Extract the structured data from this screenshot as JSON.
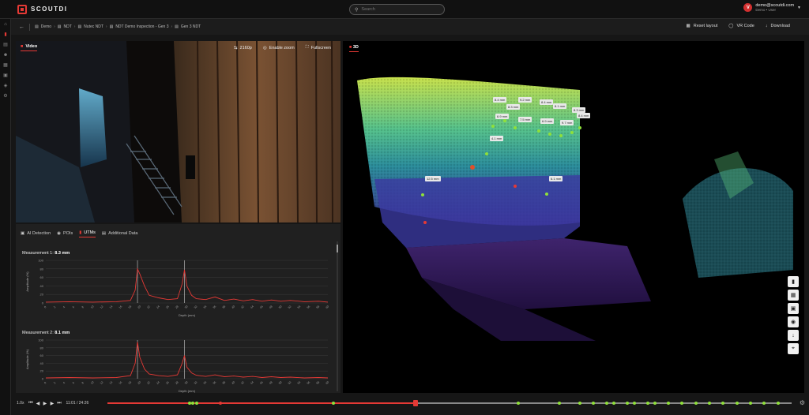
{
  "app": {
    "brand": "SCOUTDI"
  },
  "search": {
    "placeholder": "Search"
  },
  "user": {
    "initial": "V",
    "email": "demo@scoutdi.com",
    "role": "Demo • User"
  },
  "breadcrumb": [
    "Demo",
    "NDT",
    "Nutec NDT",
    "NDT Demo Inspection - Gen 3",
    "Gen 3 NDT"
  ],
  "toolbar": {
    "reset_layout": "Reset layout",
    "vr_code": "VR Code",
    "download": "Download"
  },
  "video": {
    "tab": "Video",
    "quality": "2160p",
    "zoom": "Enable zoom",
    "fullscreen": "Fullscreen"
  },
  "data_tabs": [
    "AI Detection",
    "POIs",
    "UTMs",
    "Additional Data"
  ],
  "data_active_tab": "UTMs",
  "measurements": [
    {
      "label": "Measurement 1:",
      "value": "8.3 mm"
    },
    {
      "label": "Measurement 2:",
      "value": "8.1 mm"
    }
  ],
  "chart_data": [
    {
      "type": "line",
      "title": "Measurement 1: 8.3 mm",
      "xlabel": "Depth (mm)",
      "ylabel": "Amplitude (%)",
      "ylim": [
        0,
        100
      ],
      "yticks": [
        0,
        20,
        40,
        60,
        80,
        100
      ],
      "xlim": [
        0,
        60
      ],
      "series": [
        {
          "x": [
            0,
            5,
            10,
            15,
            18,
            19,
            19.5,
            20,
            21,
            22,
            24,
            26,
            28,
            29,
            29.5,
            30,
            31,
            32,
            34,
            36,
            38,
            40,
            42,
            44,
            46,
            48,
            50,
            52,
            55,
            58,
            60
          ],
          "y": [
            2,
            3,
            2,
            3,
            6,
            30,
            80,
            68,
            40,
            18,
            12,
            8,
            10,
            45,
            78,
            40,
            18,
            10,
            8,
            14,
            6,
            9,
            5,
            8,
            4,
            7,
            4,
            6,
            3,
            4,
            2
          ]
        }
      ],
      "markers": [
        19.5,
        29.5
      ]
    },
    {
      "type": "line",
      "title": "Measurement 2: 8.1 mm",
      "xlabel": "Depth (mm)",
      "ylabel": "Amplitude (%)",
      "ylim": [
        0,
        100
      ],
      "yticks": [
        0,
        20,
        40,
        60,
        80,
        100
      ],
      "xlim": [
        0,
        60
      ],
      "series": [
        {
          "x": [
            0,
            5,
            10,
            15,
            18,
            19,
            19.5,
            20,
            21,
            22,
            24,
            26,
            28,
            29,
            29.5,
            30,
            31,
            32,
            34,
            36,
            38,
            40,
            42,
            44,
            46,
            48,
            50,
            52,
            55,
            58,
            60
          ],
          "y": [
            2,
            3,
            2,
            3,
            8,
            40,
            95,
            55,
            25,
            12,
            8,
            6,
            10,
            40,
            60,
            30,
            15,
            9,
            6,
            10,
            5,
            7,
            4,
            6,
            3,
            5,
            3,
            4,
            2,
            3,
            2
          ]
        }
      ],
      "markers": [
        19.5,
        29.5
      ]
    }
  ],
  "pointcloud_labels": [
    "8.4 mm",
    "9.2 mm",
    "8.3 mm",
    "8.4 mm",
    "8.1 mm",
    "8.3 mm",
    "8.4 mm",
    "6.9 mm",
    "7.5 mm",
    "6.9 mm",
    "9.7 mm",
    "4.1 mm",
    "12.5 mm",
    "6.1 mm"
  ],
  "view3d": {
    "tab": "3D"
  },
  "playback": {
    "speed": "1.0x",
    "timecode": "11:01 / 24:26",
    "progress": 0.45
  }
}
